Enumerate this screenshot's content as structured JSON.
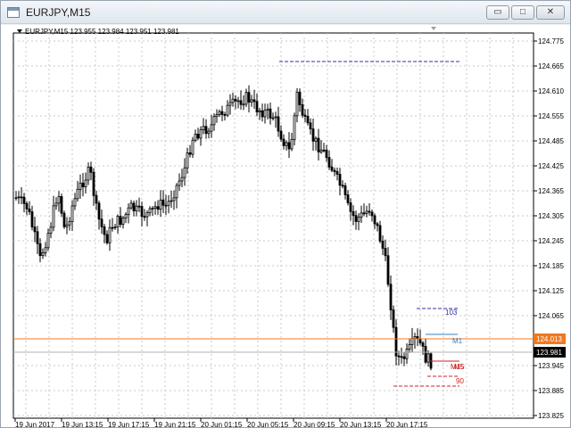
{
  "window": {
    "title": "EURJPY,M15",
    "minimize_symbol": "▭",
    "restore_symbol": "□",
    "close_symbol": "✕"
  },
  "chart": {
    "info": "EURJPY,M15  123.955 123.984 123.951 123.981",
    "price_labels": [
      "124.775",
      "124.665",
      "124.610",
      "124.555",
      "124.485",
      "124.425",
      "124.365",
      "124.305",
      "124.245",
      "124.185",
      "124.125",
      "124.065",
      "123.945",
      "123.885",
      "123.825"
    ],
    "time_labels": [
      "19 Jun 2017",
      "19 Jun 13:15",
      "19 Jun 17:15",
      "19 Jun 21:15",
      "20 Jun 01:15",
      "20 Jun 05:15",
      "20 Jun 09:15",
      "20 Jun 13:15",
      "20 Jun 17:15"
    ],
    "bid_line": {
      "value": "124.013",
      "color": "#f07820"
    },
    "last_price": {
      "value": "123.981"
    },
    "levels": [
      {
        "label": "103",
        "color": "#3030a0"
      },
      {
        "label": "M1",
        "color": "#3080c0"
      },
      {
        "label": "M15",
        "color": "#d02020"
      },
      {
        "label": "M5",
        "color": "#d02020"
      },
      {
        "label": "90",
        "color": "#d02020"
      }
    ],
    "colors": {
      "grid": "#c8c8c8",
      "candle": "#000000",
      "top_line": "#3030a0"
    }
  }
}
